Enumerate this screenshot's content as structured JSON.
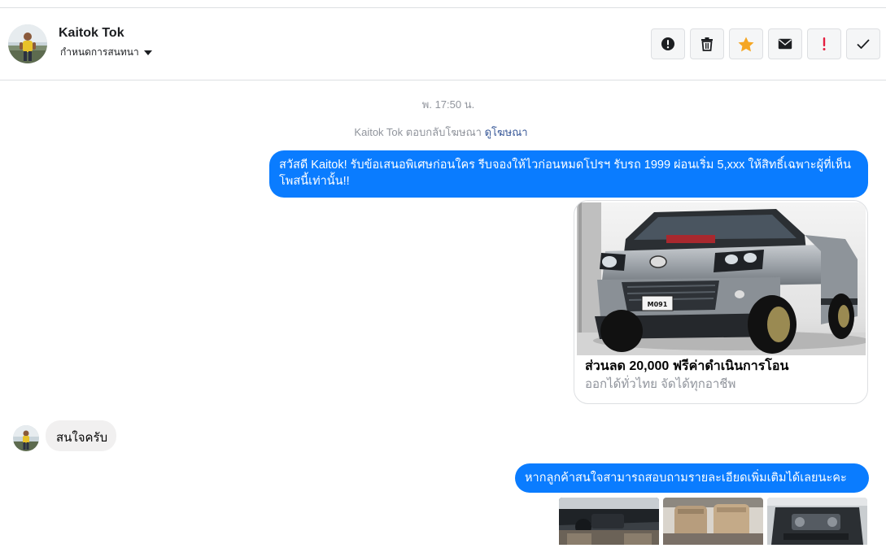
{
  "header": {
    "name": "Kaitok Tok",
    "subtitle": "กำหนดการสนทนา"
  },
  "actions": [
    {
      "icon": "info-circle-icon"
    },
    {
      "icon": "trash-icon"
    },
    {
      "icon": "star-icon"
    },
    {
      "icon": "envelope-icon"
    },
    {
      "icon": "exclamation-icon"
    },
    {
      "icon": "checkmark-icon"
    }
  ],
  "thread": {
    "timestamp": "พ. 17:50 น.",
    "ad_reply_text": "Kaitok Tok ตอบกลับโฆษณา",
    "ad_reply_link": "ดูโฆษณา",
    "messages": [
      {
        "from": "page",
        "text": "สวัสดี Kaitok! รับข้อเสนอพิเศษก่อนใคร รีบจองให้ไวก่อนหมดโปรฯ รับรถ 1999 ผ่อนเริ่ม 5,xxx ให้สิทธิ์เฉพาะผู้ที่เห็นโพสนี้เท่านั้น!!"
      },
      {
        "from": "user",
        "text": "สนใจครับ"
      },
      {
        "from": "page",
        "text": "หากลูกค้าสนใจสามารถสอบถามรายละเอียดเพิ่มเติมได้เลยนะคะ"
      }
    ],
    "ad_card": {
      "title": "ส่วนลด 20,000 ฟรีค่าดำเนินการโอน",
      "subtitle": "ออกได้ทั่วไทย จัดได้ทุกอาชีพ",
      "plate": "M091"
    }
  },
  "colors": {
    "outgoing_bubble": "#0a7cff",
    "incoming_bubble": "#f1f0f0",
    "star": "#f5a623",
    "alert": "#e41e3f",
    "link": "#385898",
    "muted": "#90949c"
  }
}
